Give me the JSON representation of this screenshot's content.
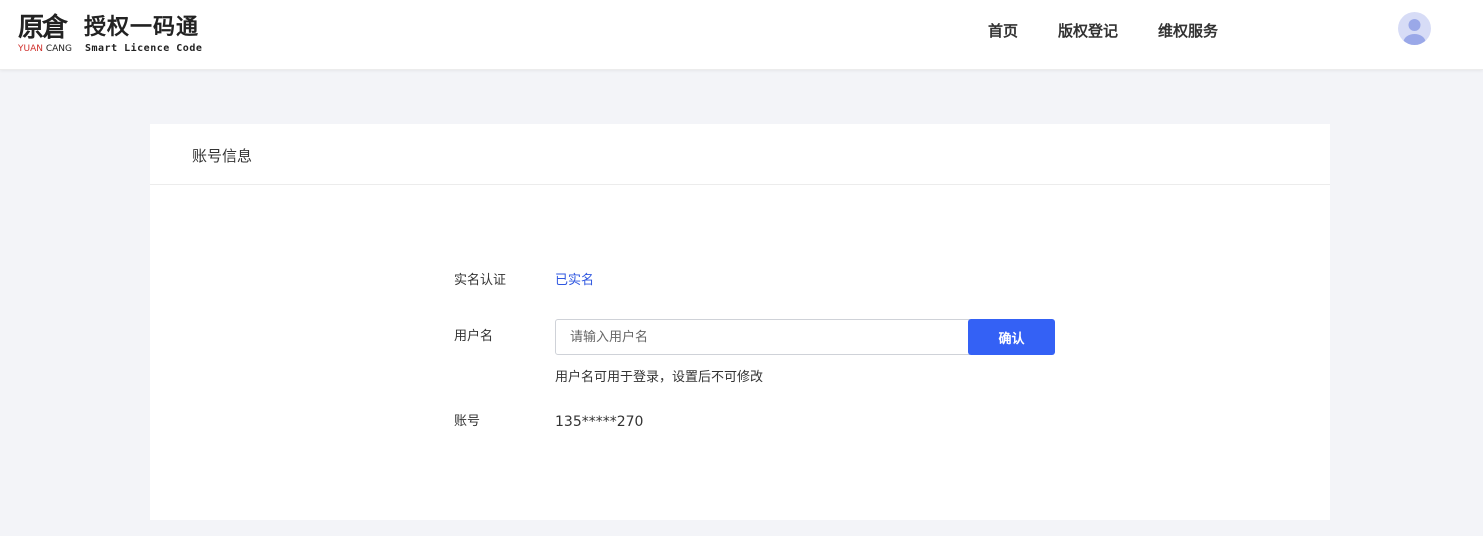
{
  "logo": {
    "mark_cn": "原倉",
    "mark_en_red": "YUAN ",
    "mark_en_dark": "CANG",
    "title": "授权一码通",
    "subtitle": "Smart Licence Code"
  },
  "nav": {
    "items": [
      {
        "label": "首页"
      },
      {
        "label": "版权登记"
      },
      {
        "label": "维权服务"
      }
    ]
  },
  "icons": {
    "avatar": "user-avatar-icon"
  },
  "colors": {
    "accent": "#3461f5",
    "link": "#2f57e0",
    "page_bg": "#f3f4f8"
  },
  "card": {
    "title": "账号信息",
    "realname": {
      "label": "实名认证",
      "value": "已实名"
    },
    "username": {
      "label": "用户名",
      "placeholder": "请输入用户名",
      "value": "",
      "confirm_label": "确认",
      "hint": "用户名可用于登录，设置后不可修改"
    },
    "account": {
      "label": "账号",
      "value": "135*****270"
    }
  }
}
